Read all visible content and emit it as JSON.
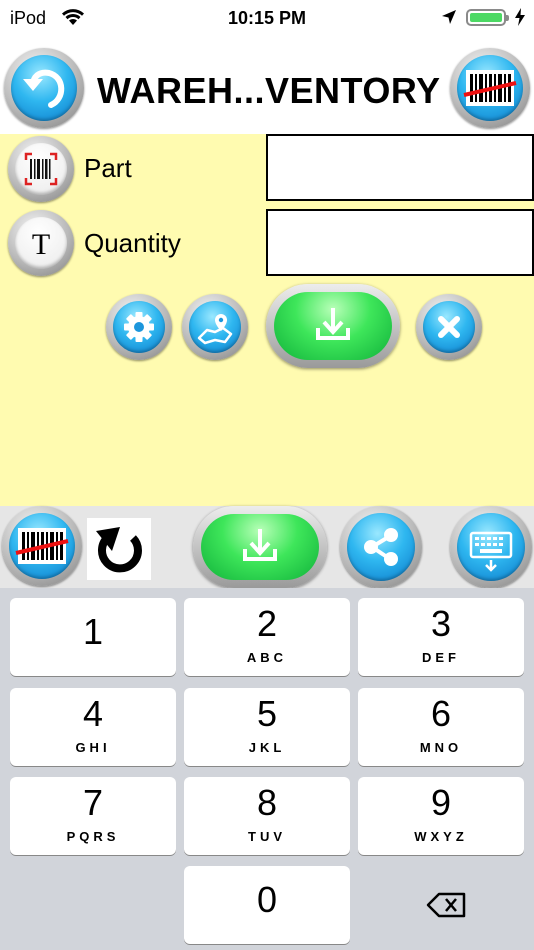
{
  "status": {
    "carrier": "iPod",
    "time": "10:15 PM",
    "battery_color": "#4cd964"
  },
  "header": {
    "title": "WAREH...VENTORY",
    "back_icon": "back-arrow-icon",
    "scan_icon": "barcode-scan-icon"
  },
  "form": {
    "background": "#fffbb0",
    "fields": [
      {
        "label": "Part",
        "icon": "barcode-icon",
        "value": ""
      },
      {
        "label": "Quantity",
        "icon": "text-t-icon",
        "value": ""
      }
    ],
    "actions": [
      "settings-icon",
      "map-location-icon",
      "download-icon",
      "close-icon"
    ]
  },
  "toolbar": {
    "buttons": [
      "barcode-scan-icon",
      "undo-icon",
      "download-icon",
      "share-icon",
      "keyboard-icon"
    ]
  },
  "keypad": {
    "keys": [
      {
        "digit": "1",
        "letters": ""
      },
      {
        "digit": "2",
        "letters": "ABC"
      },
      {
        "digit": "3",
        "letters": "DEF"
      },
      {
        "digit": "4",
        "letters": "GHI"
      },
      {
        "digit": "5",
        "letters": "JKL"
      },
      {
        "digit": "6",
        "letters": "MNO"
      },
      {
        "digit": "7",
        "letters": "PQRS"
      },
      {
        "digit": "8",
        "letters": "TUV"
      },
      {
        "digit": "9",
        "letters": "WXYZ"
      },
      {
        "digit": "0",
        "letters": ""
      }
    ],
    "backspace_icon": "backspace-icon"
  }
}
